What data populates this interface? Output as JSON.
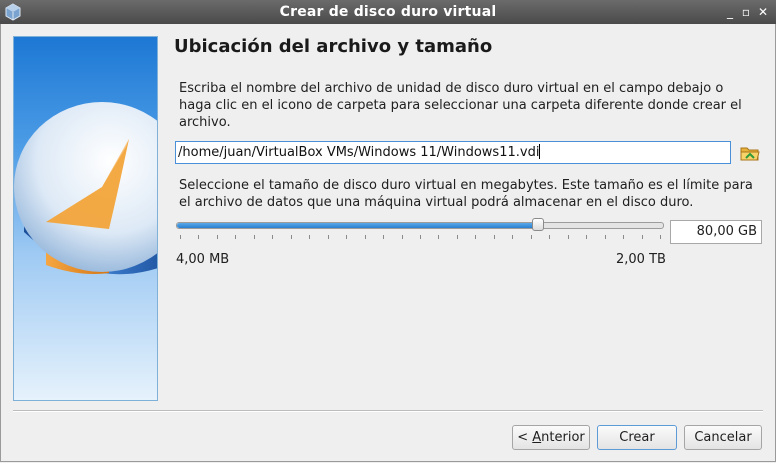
{
  "window": {
    "title": "Crear de disco duro virtual",
    "controls": {
      "minimize": "_",
      "maximize": "▫",
      "close": "✕"
    }
  },
  "page": {
    "heading": "Ubicación del archivo y tamaño",
    "location_description": "Escriba el nombre del archivo de unidad de disco duro virtual en el campo debajo o haga clic en el icono de carpeta para seleccionar una carpeta diferente donde crear el archivo.",
    "file_path": "/home/juan/VirtualBox VMs/Windows 11/Windows11.vdi",
    "size_description": "Seleccione el tamaño de disco duro virtual en megabytes. Este tamaño es el límite para el archivo de datos que una máquina virtual podrá almacenar en el disco duro.",
    "size_value": "80,00 GB",
    "slider_fraction": 0.745,
    "size_min_label": "4,00 MB",
    "size_max_label": "2,00 TB"
  },
  "buttons": {
    "back_prefix": "< ",
    "back_mnemonic": "A",
    "back_rest": "nterior",
    "create": "Crear",
    "cancel": "Cancelar"
  },
  "icons": {
    "app": "virtualbox-icon",
    "folder": "folder-open-icon"
  },
  "colors": {
    "titlebar": "#555555",
    "accent": "#4a90d9",
    "slider_fill": "#2b7fcf"
  }
}
